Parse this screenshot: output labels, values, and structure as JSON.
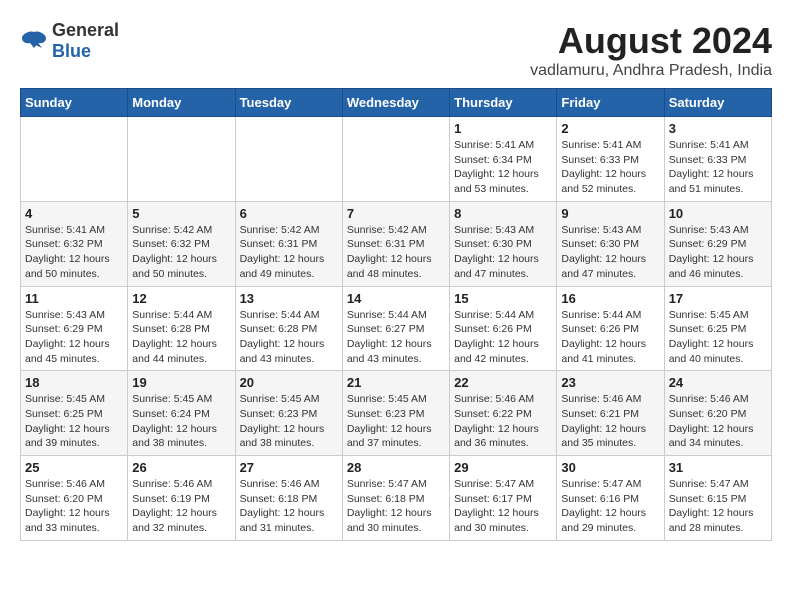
{
  "logo": {
    "general": "General",
    "blue": "Blue"
  },
  "title": "August 2024",
  "location": "vadlamuru, Andhra Pradesh, India",
  "days_of_week": [
    "Sunday",
    "Monday",
    "Tuesday",
    "Wednesday",
    "Thursday",
    "Friday",
    "Saturday"
  ],
  "weeks": [
    [
      {
        "num": "",
        "info": ""
      },
      {
        "num": "",
        "info": ""
      },
      {
        "num": "",
        "info": ""
      },
      {
        "num": "",
        "info": ""
      },
      {
        "num": "1",
        "info": "Sunrise: 5:41 AM\nSunset: 6:34 PM\nDaylight: 12 hours\nand 53 minutes."
      },
      {
        "num": "2",
        "info": "Sunrise: 5:41 AM\nSunset: 6:33 PM\nDaylight: 12 hours\nand 52 minutes."
      },
      {
        "num": "3",
        "info": "Sunrise: 5:41 AM\nSunset: 6:33 PM\nDaylight: 12 hours\nand 51 minutes."
      }
    ],
    [
      {
        "num": "4",
        "info": "Sunrise: 5:41 AM\nSunset: 6:32 PM\nDaylight: 12 hours\nand 50 minutes."
      },
      {
        "num": "5",
        "info": "Sunrise: 5:42 AM\nSunset: 6:32 PM\nDaylight: 12 hours\nand 50 minutes."
      },
      {
        "num": "6",
        "info": "Sunrise: 5:42 AM\nSunset: 6:31 PM\nDaylight: 12 hours\nand 49 minutes."
      },
      {
        "num": "7",
        "info": "Sunrise: 5:42 AM\nSunset: 6:31 PM\nDaylight: 12 hours\nand 48 minutes."
      },
      {
        "num": "8",
        "info": "Sunrise: 5:43 AM\nSunset: 6:30 PM\nDaylight: 12 hours\nand 47 minutes."
      },
      {
        "num": "9",
        "info": "Sunrise: 5:43 AM\nSunset: 6:30 PM\nDaylight: 12 hours\nand 47 minutes."
      },
      {
        "num": "10",
        "info": "Sunrise: 5:43 AM\nSunset: 6:29 PM\nDaylight: 12 hours\nand 46 minutes."
      }
    ],
    [
      {
        "num": "11",
        "info": "Sunrise: 5:43 AM\nSunset: 6:29 PM\nDaylight: 12 hours\nand 45 minutes."
      },
      {
        "num": "12",
        "info": "Sunrise: 5:44 AM\nSunset: 6:28 PM\nDaylight: 12 hours\nand 44 minutes."
      },
      {
        "num": "13",
        "info": "Sunrise: 5:44 AM\nSunset: 6:28 PM\nDaylight: 12 hours\nand 43 minutes."
      },
      {
        "num": "14",
        "info": "Sunrise: 5:44 AM\nSunset: 6:27 PM\nDaylight: 12 hours\nand 43 minutes."
      },
      {
        "num": "15",
        "info": "Sunrise: 5:44 AM\nSunset: 6:26 PM\nDaylight: 12 hours\nand 42 minutes."
      },
      {
        "num": "16",
        "info": "Sunrise: 5:44 AM\nSunset: 6:26 PM\nDaylight: 12 hours\nand 41 minutes."
      },
      {
        "num": "17",
        "info": "Sunrise: 5:45 AM\nSunset: 6:25 PM\nDaylight: 12 hours\nand 40 minutes."
      }
    ],
    [
      {
        "num": "18",
        "info": "Sunrise: 5:45 AM\nSunset: 6:25 PM\nDaylight: 12 hours\nand 39 minutes."
      },
      {
        "num": "19",
        "info": "Sunrise: 5:45 AM\nSunset: 6:24 PM\nDaylight: 12 hours\nand 38 minutes."
      },
      {
        "num": "20",
        "info": "Sunrise: 5:45 AM\nSunset: 6:23 PM\nDaylight: 12 hours\nand 38 minutes."
      },
      {
        "num": "21",
        "info": "Sunrise: 5:45 AM\nSunset: 6:23 PM\nDaylight: 12 hours\nand 37 minutes."
      },
      {
        "num": "22",
        "info": "Sunrise: 5:46 AM\nSunset: 6:22 PM\nDaylight: 12 hours\nand 36 minutes."
      },
      {
        "num": "23",
        "info": "Sunrise: 5:46 AM\nSunset: 6:21 PM\nDaylight: 12 hours\nand 35 minutes."
      },
      {
        "num": "24",
        "info": "Sunrise: 5:46 AM\nSunset: 6:20 PM\nDaylight: 12 hours\nand 34 minutes."
      }
    ],
    [
      {
        "num": "25",
        "info": "Sunrise: 5:46 AM\nSunset: 6:20 PM\nDaylight: 12 hours\nand 33 minutes."
      },
      {
        "num": "26",
        "info": "Sunrise: 5:46 AM\nSunset: 6:19 PM\nDaylight: 12 hours\nand 32 minutes."
      },
      {
        "num": "27",
        "info": "Sunrise: 5:46 AM\nSunset: 6:18 PM\nDaylight: 12 hours\nand 31 minutes."
      },
      {
        "num": "28",
        "info": "Sunrise: 5:47 AM\nSunset: 6:18 PM\nDaylight: 12 hours\nand 30 minutes."
      },
      {
        "num": "29",
        "info": "Sunrise: 5:47 AM\nSunset: 6:17 PM\nDaylight: 12 hours\nand 30 minutes."
      },
      {
        "num": "30",
        "info": "Sunrise: 5:47 AM\nSunset: 6:16 PM\nDaylight: 12 hours\nand 29 minutes."
      },
      {
        "num": "31",
        "info": "Sunrise: 5:47 AM\nSunset: 6:15 PM\nDaylight: 12 hours\nand 28 minutes."
      }
    ]
  ]
}
